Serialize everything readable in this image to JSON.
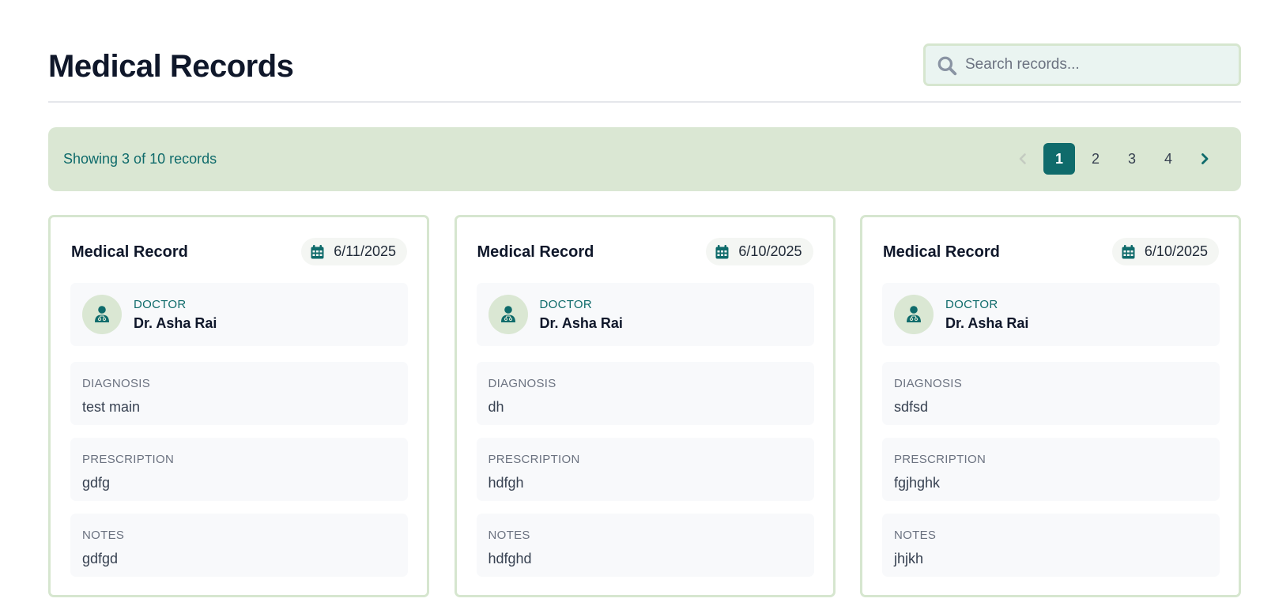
{
  "header": {
    "title": "Medical Records",
    "search": {
      "placeholder": "Search records...",
      "value": "",
      "icon": "search-icon"
    }
  },
  "info_bar": {
    "count_text": "Showing 3 of 10 records",
    "pagination": {
      "prev_icon": "chevron-left-icon",
      "next_icon": "chevron-right-icon",
      "pages": [
        "1",
        "2",
        "3",
        "4"
      ],
      "current": "1"
    }
  },
  "labels": {
    "card_title": "Medical Record",
    "doctor": "Doctor",
    "diagnosis": "Diagnosis",
    "prescription": "Prescription",
    "notes": "Notes"
  },
  "records": [
    {
      "date": "6/11/2025",
      "doctor": "Dr. Asha Rai",
      "diagnosis": "test main",
      "prescription": "gdfg",
      "notes": "gdfgd"
    },
    {
      "date": "6/10/2025",
      "doctor": "Dr. Asha Rai",
      "diagnosis": "dh",
      "prescription": "hdfgh",
      "notes": "hdfghd"
    },
    {
      "date": "6/10/2025",
      "doctor": "Dr. Asha Rai",
      "diagnosis": "sdfsd",
      "prescription": "fgjhghk",
      "notes": "jhjkh"
    }
  ],
  "colors": {
    "accent": "#0f6b6b",
    "bar_bg": "#dae7d3",
    "card_border": "#d6e6cf",
    "search_bg": "#eaf4f1"
  }
}
